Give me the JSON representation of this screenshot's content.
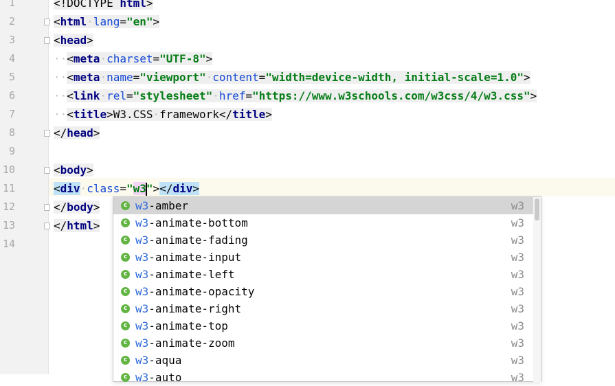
{
  "gutter": {
    "line_numbers": [
      "1",
      "2",
      "3",
      "4",
      "5",
      "6",
      "7",
      "8",
      "9",
      "10",
      "11",
      "12",
      "13",
      "14"
    ]
  },
  "editor": {
    "current_line": "11",
    "lines": [
      {
        "num": "1",
        "parts": [
          {
            "t": "<!DOCTYPE ",
            "c": "punct"
          },
          {
            "t": "html",
            "c": "tagname"
          },
          {
            "t": ">",
            "c": "punct"
          }
        ]
      },
      {
        "num": "2",
        "parts": [
          {
            "t": "<",
            "c": "punct"
          },
          {
            "t": "html",
            "c": "tagname"
          },
          {
            "t": " ",
            "c": "ws"
          },
          {
            "t": "lang",
            "c": "attr"
          },
          {
            "t": "=",
            "c": "punct"
          },
          {
            "t": "\"en\"",
            "c": "val"
          },
          {
            "t": ">",
            "c": "punct"
          }
        ]
      },
      {
        "num": "3",
        "parts": [
          {
            "t": "<",
            "c": "punct"
          },
          {
            "t": "head",
            "c": "tagname"
          },
          {
            "t": ">",
            "c": "punct"
          }
        ]
      },
      {
        "num": "4",
        "indent": true,
        "parts": [
          {
            "t": "<",
            "c": "punct"
          },
          {
            "t": "meta",
            "c": "tagname"
          },
          {
            "t": " ",
            "c": "ws"
          },
          {
            "t": "charset",
            "c": "attr"
          },
          {
            "t": "=",
            "c": "punct"
          },
          {
            "t": "\"UTF-8\"",
            "c": "val"
          },
          {
            "t": ">",
            "c": "punct"
          }
        ]
      },
      {
        "num": "5",
        "indent": true,
        "parts": [
          {
            "t": "<",
            "c": "punct"
          },
          {
            "t": "meta",
            "c": "tagname"
          },
          {
            "t": " ",
            "c": "ws"
          },
          {
            "t": "name",
            "c": "attr"
          },
          {
            "t": "=",
            "c": "punct"
          },
          {
            "t": "\"viewport\"",
            "c": "val"
          },
          {
            "t": " ",
            "c": "ws"
          },
          {
            "t": "content",
            "c": "attr"
          },
          {
            "t": "=",
            "c": "punct"
          },
          {
            "t": "\"width=device-width, initial-scale=1.0\"",
            "c": "val"
          },
          {
            "t": ">",
            "c": "punct"
          }
        ]
      },
      {
        "num": "6",
        "indent": true,
        "parts": [
          {
            "t": "<",
            "c": "punct"
          },
          {
            "t": "link",
            "c": "tagname"
          },
          {
            "t": " ",
            "c": "ws"
          },
          {
            "t": "rel",
            "c": "attr"
          },
          {
            "t": "=",
            "c": "punct"
          },
          {
            "t": "\"stylesheet\"",
            "c": "val"
          },
          {
            "t": " ",
            "c": "ws"
          },
          {
            "t": "href",
            "c": "attr"
          },
          {
            "t": "=",
            "c": "punct"
          },
          {
            "t": "\"https://www.w3schools.com/w3css/4/w3.css\"",
            "c": "val"
          },
          {
            "t": ">",
            "c": "punct"
          }
        ]
      },
      {
        "num": "7",
        "indent": true,
        "parts": [
          {
            "t": "<",
            "c": "punct"
          },
          {
            "t": "title",
            "c": "tagname"
          },
          {
            "t": ">",
            "c": "punct"
          },
          {
            "t": "W3.CSS",
            "c": "punct"
          },
          {
            "t": " ",
            "c": "ws"
          },
          {
            "t": "framework",
            "c": "punct"
          },
          {
            "t": "</",
            "c": "punct"
          },
          {
            "t": "title",
            "c": "tagname"
          },
          {
            "t": ">",
            "c": "punct"
          }
        ]
      },
      {
        "num": "8",
        "parts": [
          {
            "t": "</",
            "c": "punct"
          },
          {
            "t": "head",
            "c": "tagname"
          },
          {
            "t": ">",
            "c": "punct"
          }
        ]
      },
      {
        "num": "9",
        "parts": []
      },
      {
        "num": "10",
        "parts": [
          {
            "t": "<",
            "c": "punct"
          },
          {
            "t": "body",
            "c": "tagname"
          },
          {
            "t": ">",
            "c": "punct"
          }
        ]
      },
      {
        "num": "11",
        "current": true,
        "parts": [
          {
            "t": "<",
            "c": "punct",
            "hl": true
          },
          {
            "t": "div",
            "c": "tagname",
            "hl": true
          },
          {
            "t": " ",
            "c": "ws"
          },
          {
            "t": "class",
            "c": "attr"
          },
          {
            "t": "=",
            "c": "punct"
          },
          {
            "t": "\"",
            "c": "val"
          },
          {
            "t": "w3",
            "c": "val",
            "caret": true
          },
          {
            "t": "\"",
            "c": "val"
          },
          {
            "t": ">",
            "c": "punct"
          },
          {
            "t": "</",
            "c": "punct",
            "hl": true
          },
          {
            "t": "div",
            "c": "tagname",
            "hl": true
          },
          {
            "t": ">",
            "c": "punct",
            "hl": true
          }
        ]
      },
      {
        "num": "12",
        "parts": [
          {
            "t": "</",
            "c": "punct"
          },
          {
            "t": "body",
            "c": "tagname"
          },
          {
            "t": ">",
            "c": "punct"
          }
        ]
      },
      {
        "num": "13",
        "parts": [
          {
            "t": "</",
            "c": "punct"
          },
          {
            "t": "html",
            "c": "tagname"
          },
          {
            "t": ">",
            "c": "punct"
          }
        ]
      },
      {
        "num": "14",
        "parts": []
      }
    ]
  },
  "completion": {
    "prefix": "w3",
    "icon_letter": "c",
    "items": [
      {
        "match": "w3",
        "rest": "-amber",
        "type": "w3",
        "selected": true
      },
      {
        "match": "w3",
        "rest": "-animate-bottom",
        "type": "w3"
      },
      {
        "match": "w3",
        "rest": "-animate-fading",
        "type": "w3"
      },
      {
        "match": "w3",
        "rest": "-animate-input",
        "type": "w3"
      },
      {
        "match": "w3",
        "rest": "-animate-left",
        "type": "w3"
      },
      {
        "match": "w3",
        "rest": "-animate-opacity",
        "type": "w3"
      },
      {
        "match": "w3",
        "rest": "-animate-right",
        "type": "w3"
      },
      {
        "match": "w3",
        "rest": "-animate-top",
        "type": "w3"
      },
      {
        "match": "w3",
        "rest": "-animate-zoom",
        "type": "w3"
      },
      {
        "match": "w3",
        "rest": "-aqua",
        "type": "w3"
      },
      {
        "match": "w3",
        "rest": "-auto",
        "type": "w3"
      }
    ]
  },
  "colors": {
    "tag": "#000080",
    "attribute": "#174ad4",
    "string": "#067d17",
    "match_highlight": "#2f6ad9",
    "class_icon": "#62b543",
    "current_line_bg": "#fcfaed"
  }
}
